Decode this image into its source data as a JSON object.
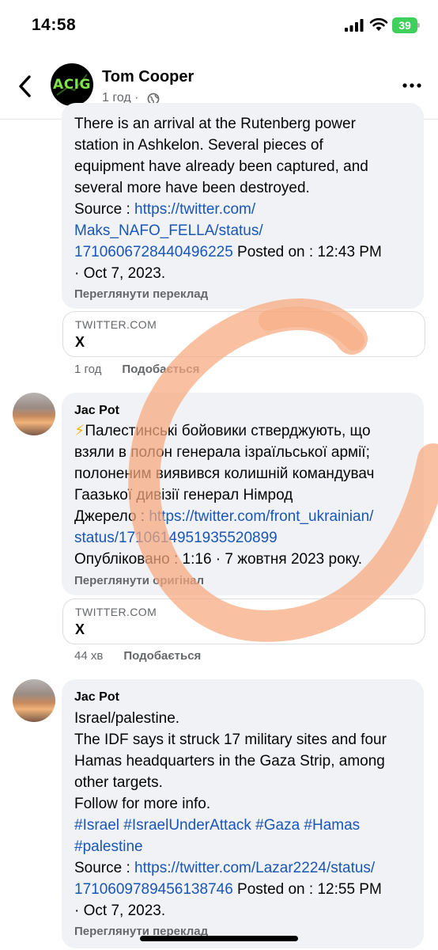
{
  "status_bar": {
    "time": "14:58",
    "battery": "39"
  },
  "header": {
    "name": "Tom Cooper",
    "time": "1 год ·",
    "avatar_label": "ACIG"
  },
  "comment1": {
    "lines": [
      "There is an arrival at the Rutenberg power",
      "station in Ashkelon.  Several pieces of",
      "equipment have already been captured, and",
      "several more have been destroyed."
    ],
    "source_label": "Source : ",
    "link_lines": [
      "https://twitter.com/",
      "Maks_NAFO_FELLA/status/",
      "1710606728440496225"
    ],
    "posted_suffix": " Posted on : 12:43 PM",
    "posted_tail": "· Oct 7, 2023.",
    "translate_action": "Переглянути переклад",
    "card": {
      "domain": "TWITTER.COM",
      "title": "X"
    },
    "meta": {
      "time": "1 год",
      "like": "Подобається"
    }
  },
  "comment2": {
    "author": "Jac Pot",
    "emoji": "⚡",
    "lines": [
      "Палестинські бойовики стверджують, що",
      "взяли в полон генерала ізраїльської армії;",
      "полоненим виявився колишній командувач",
      "Гаазької дивізії генерал Німрод"
    ],
    "source_label": "Джерело : ",
    "link_line1": "https://twitter.com/front_ukrainian/",
    "link_line2": "status/1710614951935520899",
    "posted": "Опубліковано : 1:16 · 7 жовтня 2023 року.",
    "original_action": "Переглянути оригінал",
    "card": {
      "domain": "TWITTER.COM",
      "title": "X"
    },
    "meta": {
      "time": "44 хв",
      "like": "Подобається"
    }
  },
  "comment3": {
    "author": "Jac Pot",
    "lines": [
      "Israel/palestine.",
      "The IDF says it struck 17 military sites and four",
      "Hamas headquarters in the Gaza Strip, among",
      "other targets.",
      "Follow for more info."
    ],
    "hashtags1": "#Israel #IsraelUnderAttack #Gaza #Hamas",
    "hashtags2": "#palestine",
    "source_label": "Source : ",
    "link_line1": "https://twitter.com/Lazar2224/status/",
    "link_line2": "1710609789456138746",
    "posted_suffix": " Posted on : 12:55 PM",
    "posted_tail": "· Oct 7, 2023.",
    "translate_action": "Переглянути переклад"
  },
  "colors": {
    "link": "#1a56b6",
    "bubble": "#f0f2f5",
    "meta": "#65676b",
    "swirl": "#f7a77d"
  }
}
